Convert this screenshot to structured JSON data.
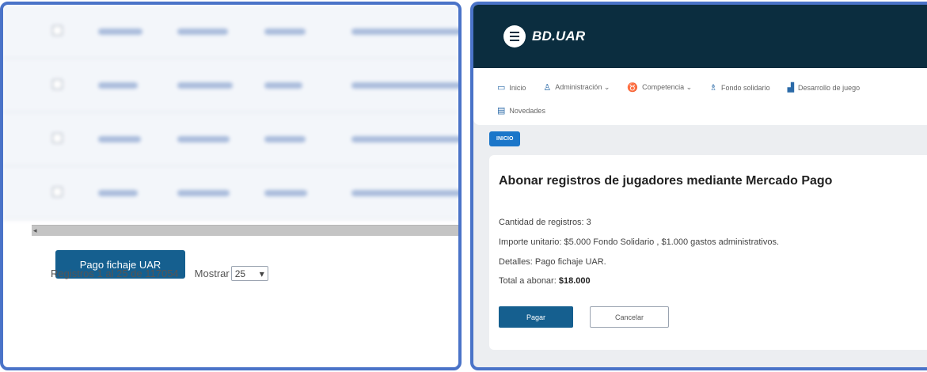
{
  "left": {
    "pay_button_label": "Pago fichaje UAR",
    "records_text": "Registros 1 al 25 de 117054",
    "show_label": "Mostrar",
    "page_size_value": "25",
    "page_size_arrow": "▾"
  },
  "right": {
    "brand": "BD.UAR",
    "nav": [
      {
        "label": "Inicio",
        "icon": "monitor-icon"
      },
      {
        "label": "Administración ⌄",
        "icon": "admin-icon"
      },
      {
        "label": "Competencia ⌄",
        "icon": "trophy-icon"
      },
      {
        "label": "Fondo solidario",
        "icon": "person-icon"
      },
      {
        "label": "Desarrollo de juego",
        "icon": "chart-icon"
      },
      {
        "label": "Novedades",
        "icon": "news-icon"
      }
    ],
    "breadcrumb": "INICIO",
    "card": {
      "title": "Abonar registros de jugadores mediante Mercado Pago",
      "quantity": "Cantidad de registros: 3",
      "unit_price": "Importe unitario: $5.000 Fondo Solidario , $1.000 gastos administrativos.",
      "details": "Detalles: Pago fichaje UAR.",
      "total_label": "Total a abonar:",
      "total_value": "$18.000",
      "pay_label": "Pagar",
      "cancel_label": "Cancelar"
    }
  },
  "colors": {
    "accent_border": "#4a73c8",
    "header_bg": "#0b2d3f",
    "primary_button": "#155f8f",
    "breadcrumb_bg": "#1b76c9"
  }
}
